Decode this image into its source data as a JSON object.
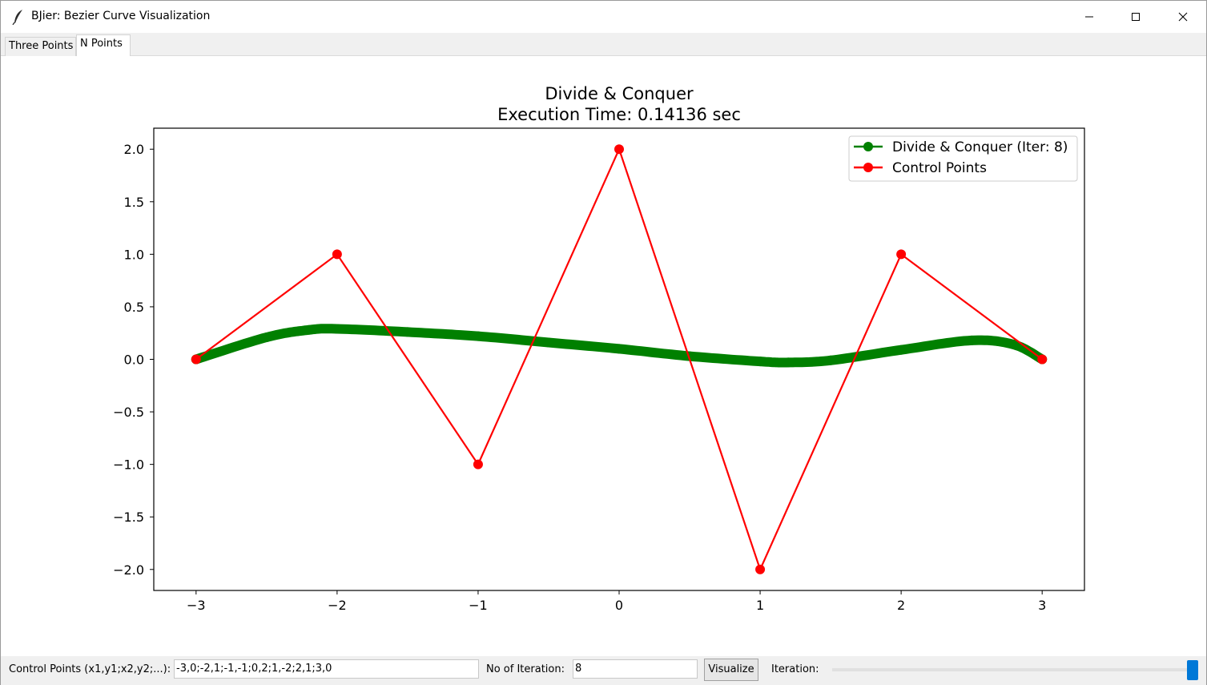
{
  "window": {
    "title": "BJier: Bezier Curve Visualization",
    "icons": [
      "feather-icon",
      "minimize-icon",
      "maximize-icon",
      "close-icon"
    ]
  },
  "tabs": [
    {
      "label": "Three Points",
      "selected": false
    },
    {
      "label": "N Points",
      "selected": true
    }
  ],
  "chart_data": {
    "type": "line",
    "title": "Divide & Conquer",
    "subtitle": "Execution Time: 0.14136 sec",
    "xlim": [
      -3.3,
      3.3
    ],
    "ylim": [
      -2.2,
      2.2
    ],
    "x_ticks": [
      -3,
      -2,
      -1,
      0,
      1,
      2,
      3
    ],
    "x_tick_labels": [
      "−3",
      "−2",
      "−1",
      "0",
      "1",
      "2",
      "3"
    ],
    "y_ticks": [
      2.0,
      1.5,
      1.0,
      0.5,
      0.0,
      -0.5,
      -1.0,
      -1.5,
      -2.0
    ],
    "y_tick_labels": [
      "2.0",
      "1.5",
      "1.0",
      "0.5",
      "0.0",
      "−0.5",
      "−1.0",
      "−1.5",
      "−2.0"
    ],
    "grid": false,
    "legend_position": "top-right",
    "series": [
      {
        "name": "Divide & Conquer (Iter: 8)",
        "color": "#008000",
        "marker": "circle",
        "iterations": 8,
        "points": [
          [
            -3,
            0.0
          ],
          [
            -2.5,
            0.21
          ],
          [
            -2.2,
            0.28
          ],
          [
            -2.0,
            0.29
          ],
          [
            -1.5,
            0.26
          ],
          [
            -1.0,
            0.22
          ],
          [
            -0.5,
            0.16
          ],
          [
            0.0,
            0.1
          ],
          [
            0.5,
            0.03
          ],
          [
            1.0,
            -0.02
          ],
          [
            1.2,
            -0.03
          ],
          [
            1.5,
            -0.01
          ],
          [
            2.0,
            0.09
          ],
          [
            2.5,
            0.18
          ],
          [
            2.8,
            0.14
          ],
          [
            3,
            0.0
          ]
        ]
      },
      {
        "name": "Control Points",
        "color": "#ff0000",
        "marker": "circle",
        "points": [
          [
            -3,
            0
          ],
          [
            -2,
            1
          ],
          [
            -1,
            -1
          ],
          [
            0,
            2
          ],
          [
            1,
            -2
          ],
          [
            2,
            1
          ],
          [
            3,
            0
          ]
        ]
      }
    ]
  },
  "toolbar": {
    "points_label": "Control Points (x1,y1;x2,y2;...):",
    "points_value": "-3,0;-2,1;-1,-1;0,2;1,-2;2,1;3,0",
    "iter_label": "No of Iteration:",
    "iter_value": "8",
    "visualize_label": "Visualize",
    "slider_label": "Iteration:",
    "slider_fraction": 1.0
  }
}
